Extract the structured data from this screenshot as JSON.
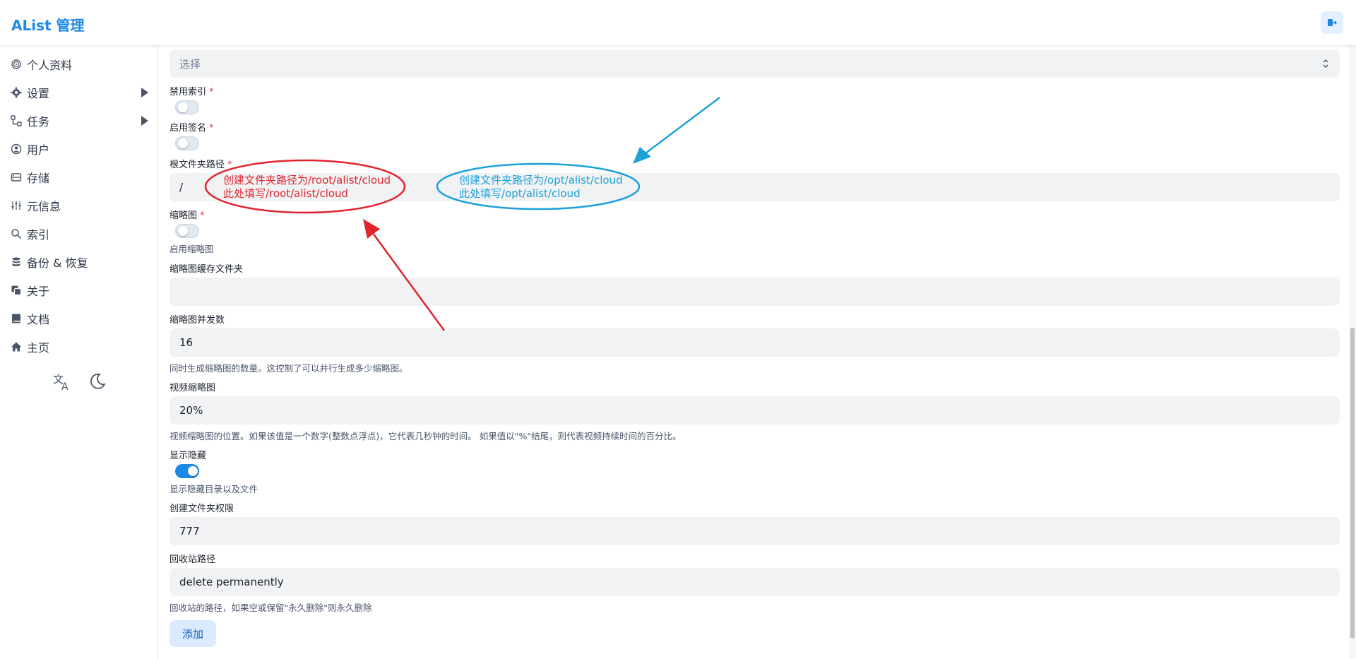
{
  "header": {
    "title": "AList 管理",
    "logout_icon": "logout-icon"
  },
  "sidebar": {
    "items": [
      {
        "label": "个人资料",
        "icon": "fingerprint-icon"
      },
      {
        "label": "设置",
        "icon": "gear-icon"
      },
      {
        "label": "任务",
        "icon": "flow-icon"
      },
      {
        "label": "用户",
        "icon": "user-circle-icon"
      },
      {
        "label": "存储",
        "icon": "database-icon"
      },
      {
        "label": "元信息",
        "icon": "sliders-icon"
      },
      {
        "label": "索引",
        "icon": "search-icon"
      },
      {
        "label": "备份 & 恢复",
        "icon": "stack-icon"
      },
      {
        "label": "关于",
        "icon": "copy-icon"
      },
      {
        "label": "文档",
        "icon": "book-icon"
      },
      {
        "label": "主页",
        "icon": "home-icon"
      }
    ],
    "tools": {
      "translate_icon": "translate-icon",
      "theme_icon": "moon-icon"
    }
  },
  "form": {
    "select_placeholder": "选择",
    "disable_index_label": "禁用索引",
    "enable_sign_label": "启用签名",
    "root_folder_label": "根文件夹路径",
    "root_folder_value": "/",
    "thumbnail_label": "缩略图",
    "thumbnail_help": "启用缩略图",
    "thumb_cache_label": "缩略图缓存文件夹",
    "thumb_cache_value": "",
    "thumb_concurrency_label": "缩略图并发数",
    "thumb_concurrency_value": "16",
    "thumb_concurrency_help": "同时生成缩略图的数量。这控制了可以并行生成多少缩略图。",
    "video_thumb_label": "视频缩略图",
    "video_thumb_value": "20%",
    "video_thumb_help": "视频缩略图的位置。如果该值是一个数字(整数点浮点)，它代表几秒钟的时间。 如果值以\"%\"结尾，则代表视频持续时间的百分比。",
    "show_hidden_label": "显示隐藏",
    "show_hidden_help": "显示隐藏目录以及文件",
    "mkdir_perm_label": "创建文件夹权限",
    "mkdir_perm_value": "777",
    "recycle_label": "回收站路径",
    "recycle_value": "delete permanently",
    "recycle_help": "回收站的路径，如果空或保留\"永久删除\"则永久删除",
    "add_button": "添加",
    "required_mark": "*"
  },
  "annotations": {
    "red_line1": "创建文件夹路径为/root/alist/cloud",
    "red_line2": "此处填写/root/alist/cloud",
    "blue_line1": "创建文件夹路径为/opt/alist/cloud",
    "blue_line2": "此处填写/opt/alist/cloud",
    "red_color": "#e0242e",
    "blue_color": "#1da1d8"
  },
  "colors": {
    "accent": "#1e88e5"
  }
}
